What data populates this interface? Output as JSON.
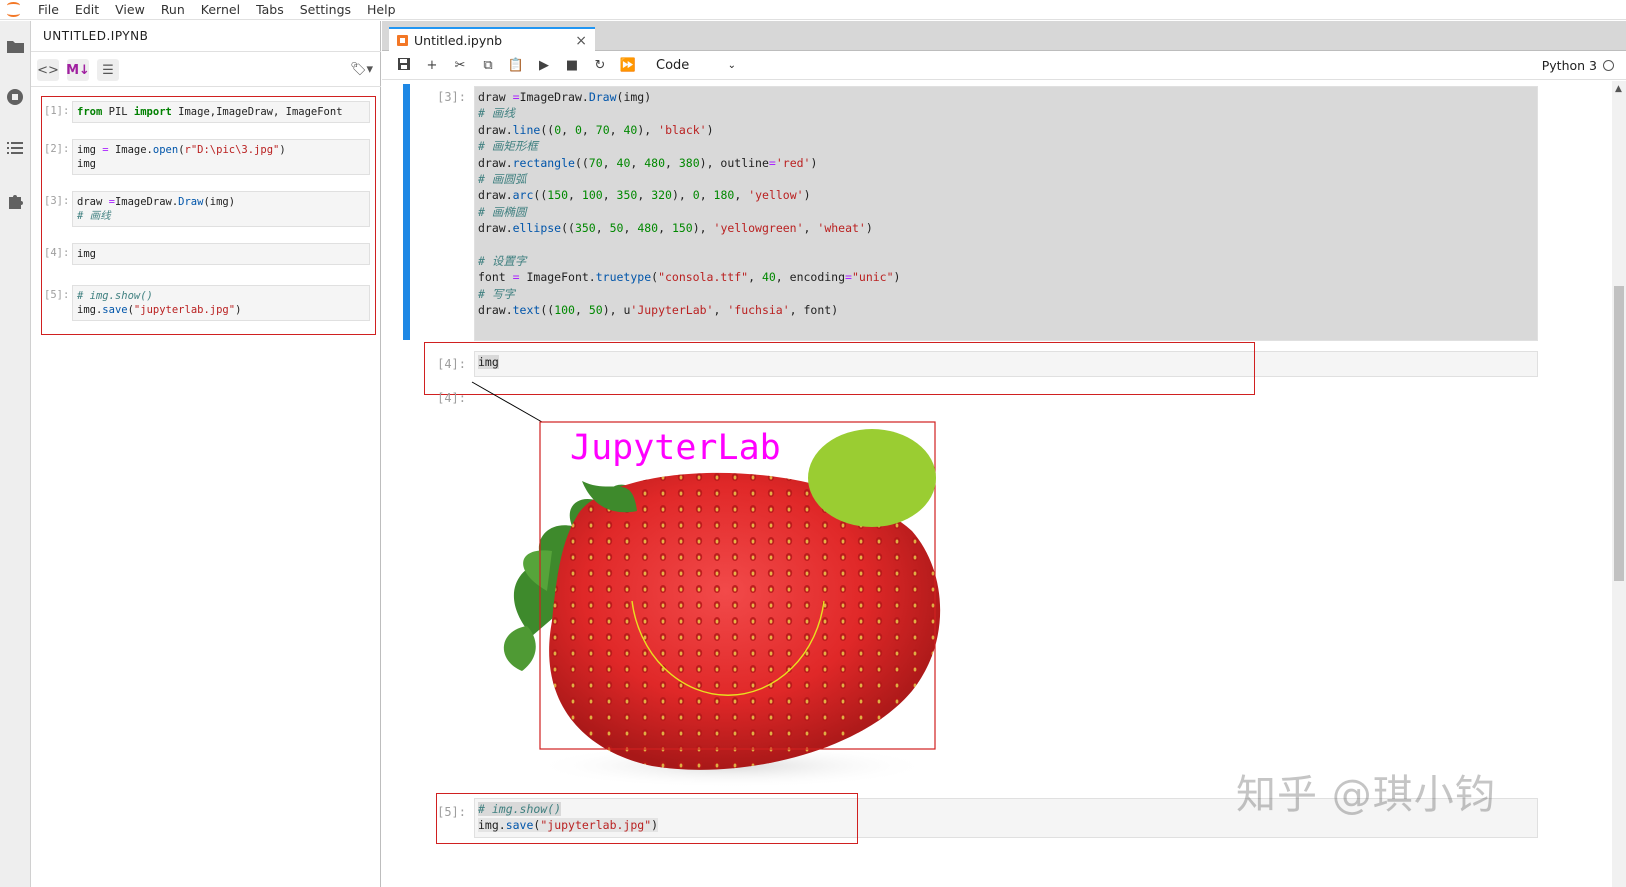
{
  "menu": [
    "File",
    "Edit",
    "View",
    "Run",
    "Kernel",
    "Tabs",
    "Settings",
    "Help"
  ],
  "left_panel": {
    "title": "UNTITLED.IPYNB",
    "cells": [
      {
        "prompt": "[1]:",
        "code": "from PIL import Image,ImageDraw, ImageFont"
      },
      {
        "prompt": "[2]:",
        "code": "img = Image.open(r\"D:\\pic\\3.jpg\")\nimg"
      },
      {
        "prompt": "[3]:",
        "code": "draw =ImageDraw.Draw(img)\n# 画线"
      },
      {
        "prompt": "[4]:",
        "code": "img"
      },
      {
        "prompt": "[5]:",
        "code": "# img.show()\nimg.save(\"jupyterlab.jpg\")"
      }
    ]
  },
  "tab": {
    "label": "Untitled.ipynb",
    "close": "×"
  },
  "toolbar": {
    "cell_type": "Code",
    "kernel": "Python 3"
  },
  "notebook": {
    "cell3_prompt": "[3]:",
    "cell4_prompt": "[4]:",
    "out4_prompt": "[4]:",
    "cell4_code": "img",
    "cell5_prompt": "[5]:",
    "cell5_line1": "# img.show()",
    "cell5_line2_a": "img.",
    "cell5_line2_b": "save",
    "cell5_line2_c": "(",
    "cell5_line2_d": "\"jupyterlab.jpg\"",
    "cell5_line2_e": ")"
  },
  "image_text": "JupyterLab",
  "watermark": "知乎 @琪小钧",
  "colors": {
    "accent": "#2196f3",
    "collapser": "#1e88e5",
    "annotation": "#d02020",
    "jupyter_orange": "#f37726"
  }
}
